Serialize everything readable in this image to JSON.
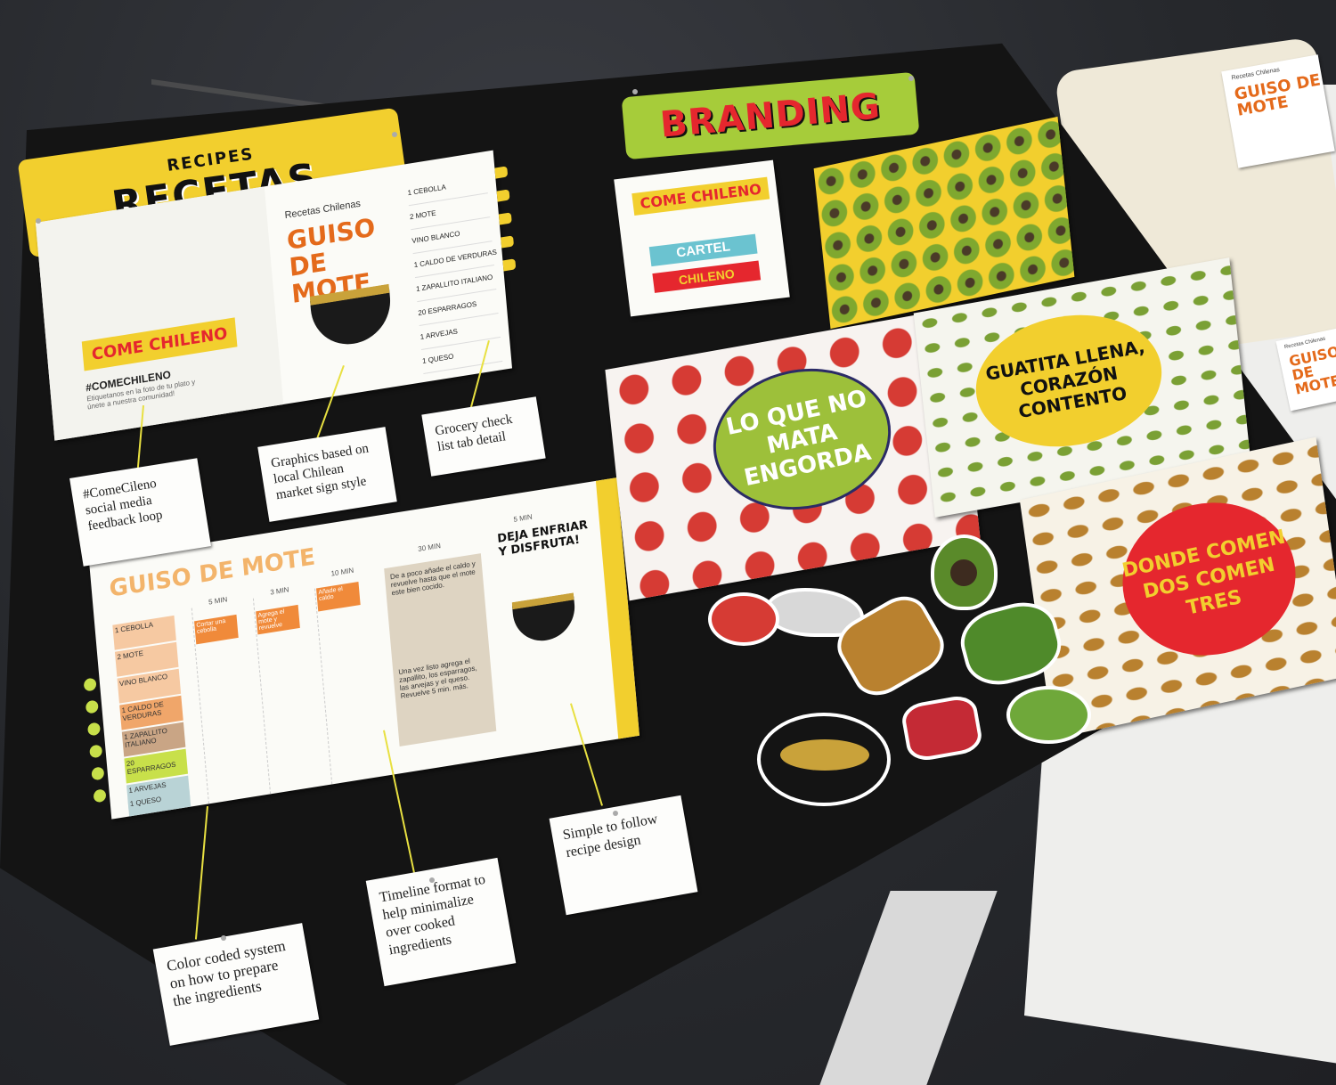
{
  "banners": {
    "recetas_small": "RECIPES",
    "recetas_big": "RECETAS",
    "branding": "BRANDING"
  },
  "recipe_card_1": {
    "logo": "COME CHILENO",
    "hashtag": "#COMECHILENO",
    "hashtag_sub": "Etiquetanos en la foto de tu plato y únete a nuestra comunidad!",
    "kicker": "Recetas Chilenas",
    "title": "GUISO DE MOTE",
    "ingredients": [
      "1 CEBOLLA",
      "2 MOTE",
      "VINO BLANCO",
      "1 CALDO DE VERDURAS",
      "1 ZAPALLITO ITALIANO",
      "20 ESPARRAGOS",
      "1 ARVEJAS",
      "1 QUESO"
    ]
  },
  "recipe_card_2": {
    "title": "GUISO DE MOTE",
    "times": [
      "5 MIN",
      "3 MIN",
      "10 MIN",
      "30 MIN",
      "5 MIN"
    ],
    "tags": [
      "1 CEBOLLA",
      "2 MOTE",
      "VINO BLANCO",
      "1 CALDO DE VERDURAS",
      "1 ZAPALLITO ITALIANO",
      "20 ESPARRAGOS",
      "1 ARVEJAS",
      "1 QUESO"
    ],
    "steps": [
      "Cortar una cebolla",
      "Agrega el mote y revuelve",
      "Añade el caldo"
    ],
    "panel_top": "De a poco añade el caldo y revuelve hasta que el mote este bien cocido.",
    "panel_bottom": "Una vez listo agrega el zapallito, los esparragos, las arvejas y el queso. Revuelve 5 min. más.",
    "final": "DEJA ENFRIAR Y DISFRUTA!"
  },
  "notes": {
    "social": "#ComeCileno social media feedback loop",
    "graphics": "Graphics based on local Chilean market sign style",
    "grocery": "Grocery check list tab detail",
    "color": "Color coded system on how to prepare the ingredients",
    "timeline": "Timeline format to help minimalize over cooked ingredients",
    "simple": "Simple to follow recipe design"
  },
  "branding": {
    "cartel_logo": "COME CHILENO",
    "cartel_line1": "CARTEL",
    "cartel_line2": "CHILENO",
    "poster_green": "LO QUE NO MATA ENGORDA",
    "poster_yellow": "GUATITA LLENA, CORAZÓN CONTENTO",
    "poster_red": "DONDE COMEN DOS COMEN TRES"
  },
  "table_items": {
    "mini_kicker": "Recetas Chilenas",
    "mini_title": "GUISO DE MOTE"
  },
  "colors": {
    "yellow": "#f2cf2e",
    "red": "#e5272e",
    "green": "#9dc03a",
    "orange": "#e46a1b",
    "board": "#141414"
  }
}
